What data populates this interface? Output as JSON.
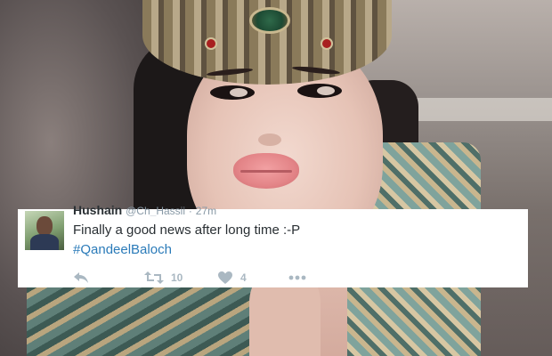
{
  "tweet": {
    "author_name": "Hushain",
    "author_handle": "@Ch_Hassii",
    "separator": "·",
    "time": "27m",
    "text": "Finally a good news after long time :-P",
    "hashtag": "#QandeelBaloch",
    "retweet_count": "10",
    "like_count": "4"
  },
  "icons": {
    "reply": "reply-icon",
    "retweet": "retweet-icon",
    "like": "heart-icon",
    "more": "more-icon"
  },
  "colors": {
    "text": "#292f33",
    "muted": "#8899a6",
    "link": "#2b7bb9",
    "action": "#aab8c2"
  }
}
